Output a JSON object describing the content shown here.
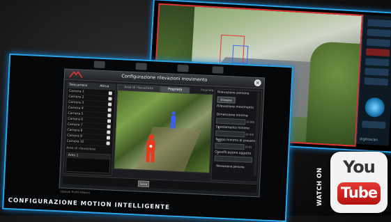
{
  "dialog": {
    "title": "Configurazione rilevazioni movimento",
    "close_glyph": "×",
    "footer_button": "Salva"
  },
  "camera_list": {
    "header_name": "Telecamera",
    "header_attiva": "Attiva",
    "rows": [
      "Camera 1",
      "Camera 2",
      "Camera 3",
      "Camera 4",
      "Camera 5",
      "Camera 6",
      "Camera 7",
      "Camera 8",
      "Camera 9",
      "Camera 10",
      "Camera 11"
    ],
    "section_label": "Aree di rilevazione",
    "area_item": "Area 1"
  },
  "tabs": [
    "Aree di rilevazione",
    "Proprietà"
  ],
  "properties": {
    "section_title": "Rilevazione persone",
    "button": "Disegna",
    "sub_title": "Rilevazione movimento",
    "fields": [
      {
        "label": "Dimensione minima",
        "value": "5",
        "unit": "(0-99)"
      },
      {
        "label": "Spostamento minimo",
        "value": "10",
        "unit": "(0-99)"
      },
      {
        "label": "Tempo minimo di presenza",
        "value": "1",
        "unit": "(0-9)"
      },
      {
        "label": "Classificazione oggetto",
        "value": "Rilevazione persone",
        "unit": ""
      }
    ],
    "top_hint": "Proprietà"
  },
  "bottom_tabs": "Opzioni   Profili   Allarmi",
  "caption": "CONFIGURAZIONE MOTION INTELLIGENTE",
  "back_screen": {
    "brand": "digitoscan"
  },
  "watch_on": "WATCH ON",
  "youtube": {
    "you": "You",
    "tube": "Tube"
  },
  "icons": [
    "close-icon",
    "logo-icon",
    "person-icon",
    "joystick-icon"
  ],
  "colors": {
    "screen_border": "#2aa6e8",
    "detection_red": "#e33333",
    "detection_blue": "#3366ff",
    "youtube_red": "#d0201b"
  }
}
